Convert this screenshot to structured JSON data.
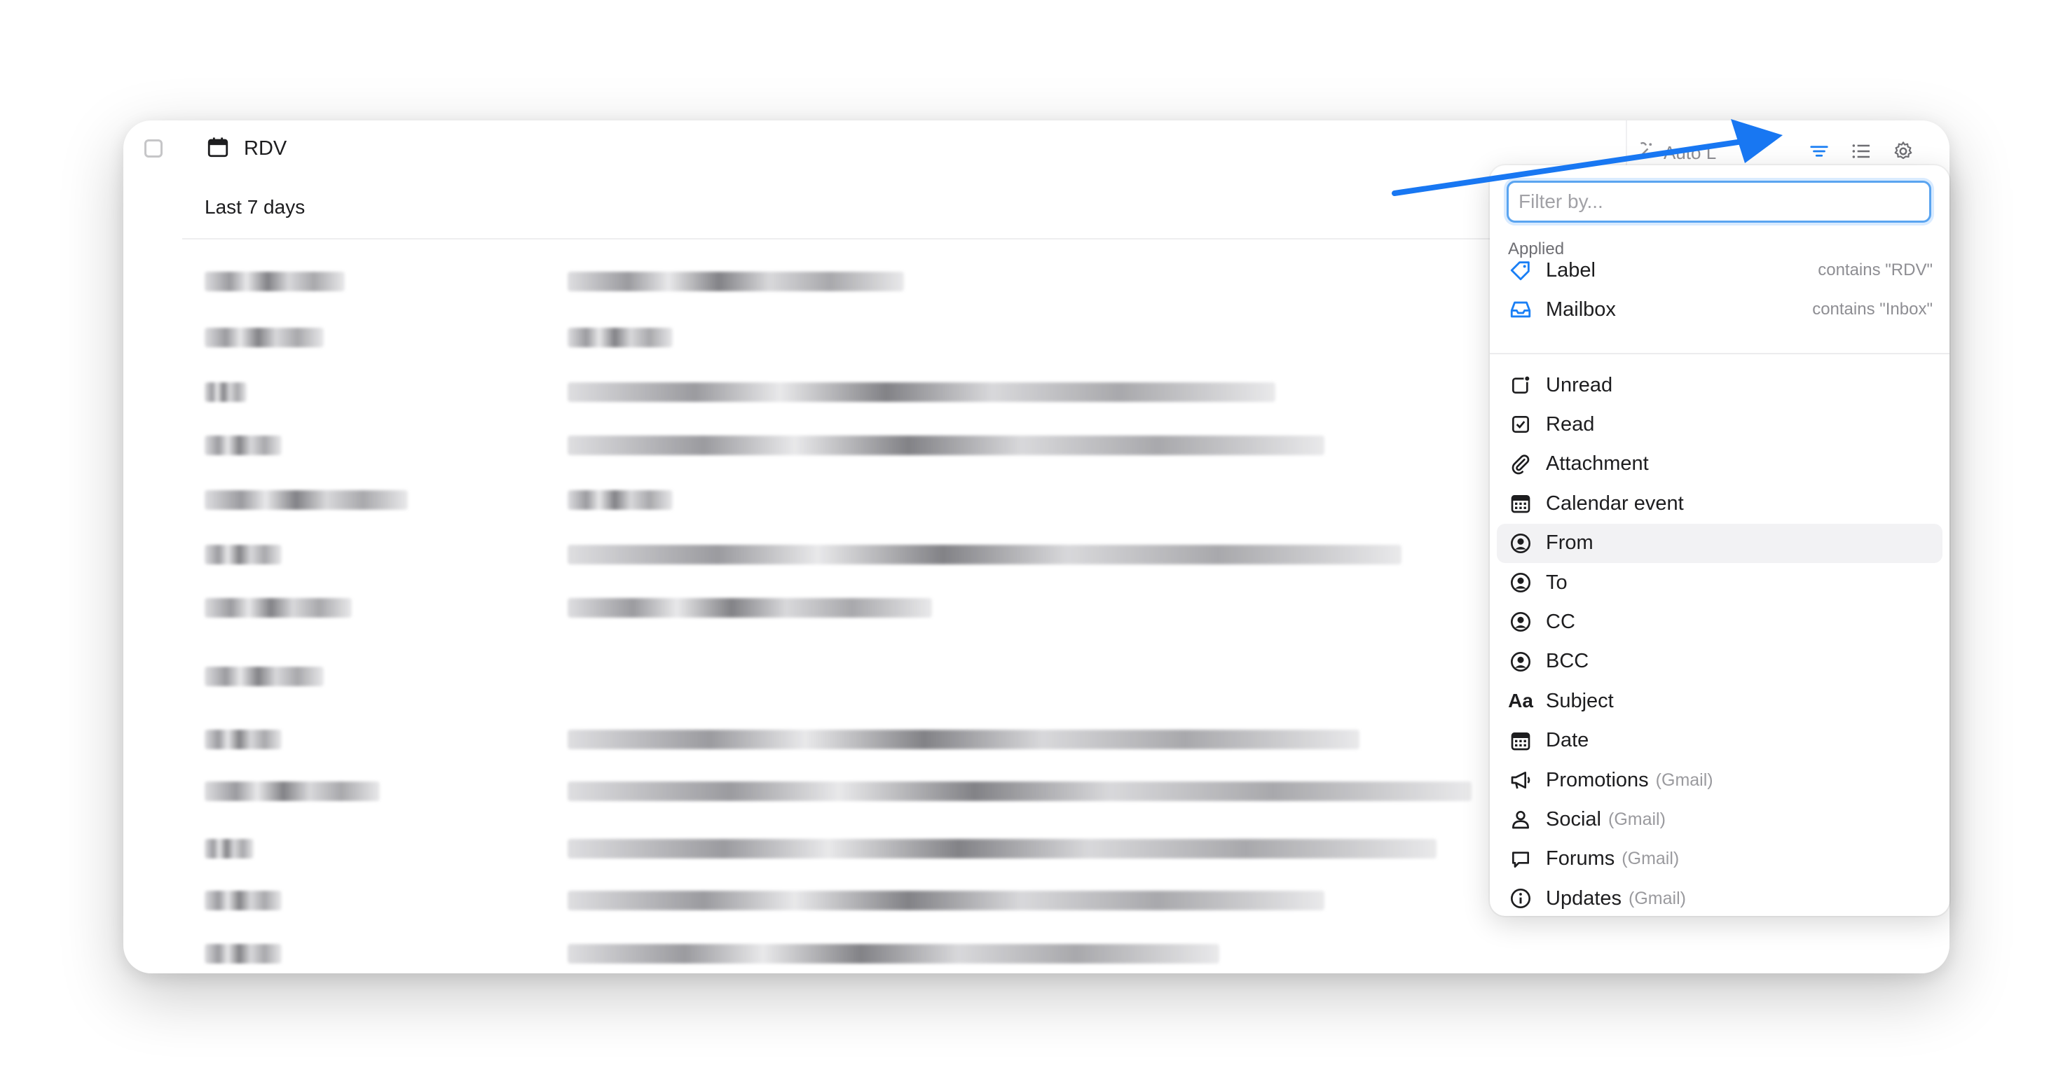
{
  "window": {
    "title": "RDV"
  },
  "toolbar": {
    "auto_label": "Auto L"
  },
  "list": {
    "section_title": "Last 7 days",
    "rows": [
      {
        "sender_w": 200,
        "subject_w": 480
      },
      {
        "sender_w": 170,
        "subject_w": 150
      },
      {
        "sender_w": 60,
        "subject_w": 1010
      },
      {
        "sender_w": 110,
        "subject_w": 1080
      },
      {
        "sender_w": 290,
        "subject_w": 150
      },
      {
        "sender_w": 110,
        "subject_w": 1190
      },
      {
        "sender_w": 210,
        "subject_w": 520
      },
      {
        "group": true,
        "sender_w": 170
      },
      {
        "sender_w": 110,
        "subject_w": 1130
      },
      {
        "sender_w": 250,
        "subject_w": 1290
      },
      {
        "sender_w": 70,
        "subject_w": 1240
      },
      {
        "sender_w": 110,
        "subject_w": 1080
      },
      {
        "sender_w": 110,
        "subject_w": 930
      }
    ]
  },
  "filter_menu": {
    "search_placeholder": "Filter by...",
    "applied_heading": "Applied",
    "applied": [
      {
        "label": "Label",
        "condition": "contains \"RDV\"",
        "icon": "tag-icon"
      },
      {
        "label": "Mailbox",
        "condition": "contains \"Inbox\"",
        "icon": "inbox-icon"
      }
    ],
    "options": [
      {
        "label": "Unread",
        "suffix": "",
        "icon": "unread-icon"
      },
      {
        "label": "Read",
        "suffix": "",
        "icon": "checkbox-icon"
      },
      {
        "label": "Attachment",
        "suffix": "",
        "icon": "paperclip-icon"
      },
      {
        "label": "Calendar event",
        "suffix": "",
        "icon": "calendar-icon"
      },
      {
        "label": "From",
        "suffix": "",
        "icon": "person-circle-icon"
      },
      {
        "label": "To",
        "suffix": "",
        "icon": "person-circle-icon"
      },
      {
        "label": "CC",
        "suffix": "",
        "icon": "person-circle-icon"
      },
      {
        "label": "BCC",
        "suffix": "",
        "icon": "person-circle-icon"
      },
      {
        "label": "Subject",
        "suffix": "",
        "icon": "text-icon"
      },
      {
        "label": "Date",
        "suffix": "",
        "icon": "calendar-icon"
      },
      {
        "label": "Promotions",
        "suffix": "(Gmail)",
        "icon": "megaphone-icon"
      },
      {
        "label": "Social",
        "suffix": "(Gmail)",
        "icon": "person-icon"
      },
      {
        "label": "Forums",
        "suffix": "(Gmail)",
        "icon": "chat-bubble-icon"
      },
      {
        "label": "Updates",
        "suffix": "(Gmail)",
        "icon": "info-icon"
      }
    ],
    "text_icon_glyph": "Aa"
  },
  "colors": {
    "accent": "#1a7ff5",
    "arrow": "#1877f2"
  }
}
